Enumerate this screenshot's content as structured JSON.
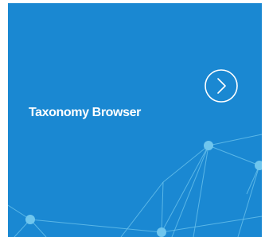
{
  "tile": {
    "title": "Taxonomy Browser",
    "background_color": "#1a88d2",
    "accent_color": "#5ec4f0",
    "action_icon": "chevron-right-circle-icon",
    "decoration": "network-graph"
  }
}
